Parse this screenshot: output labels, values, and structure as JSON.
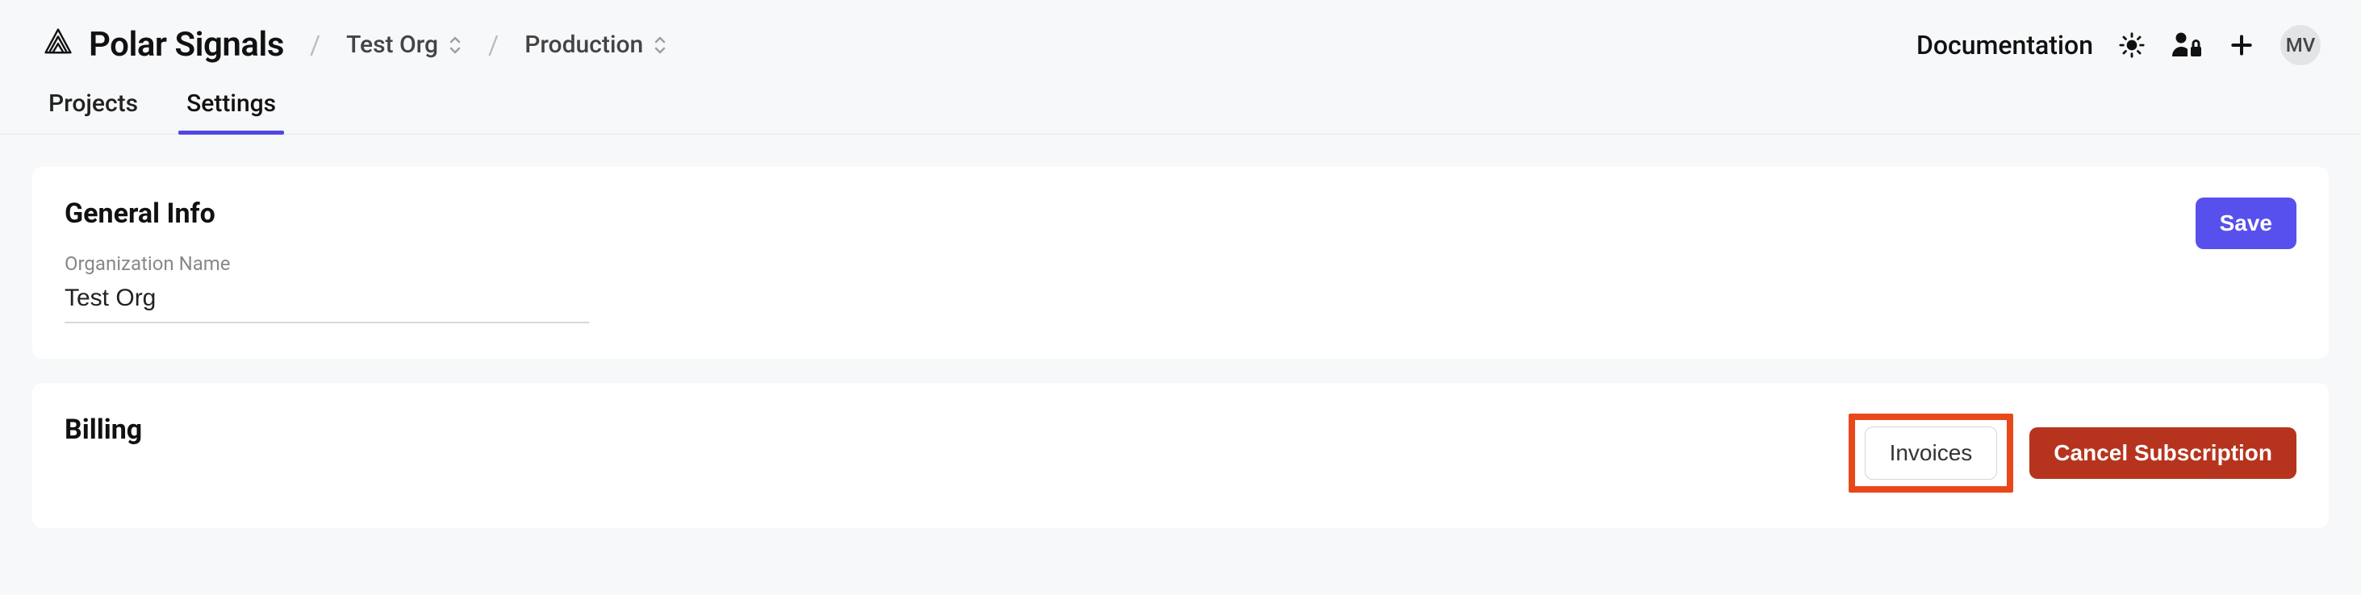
{
  "brand": "Polar Signals",
  "breadcrumb": {
    "org": "Test Org",
    "project": "Production"
  },
  "topbar": {
    "documentation": "Documentation",
    "avatar_initials": "MV"
  },
  "tabs": {
    "projects": "Projects",
    "settings": "Settings"
  },
  "general": {
    "title": "General Info",
    "org_name_label": "Organization Name",
    "org_name_value": "Test Org",
    "save_label": "Save"
  },
  "billing": {
    "title": "Billing",
    "invoices_label": "Invoices",
    "cancel_label": "Cancel Subscription"
  }
}
